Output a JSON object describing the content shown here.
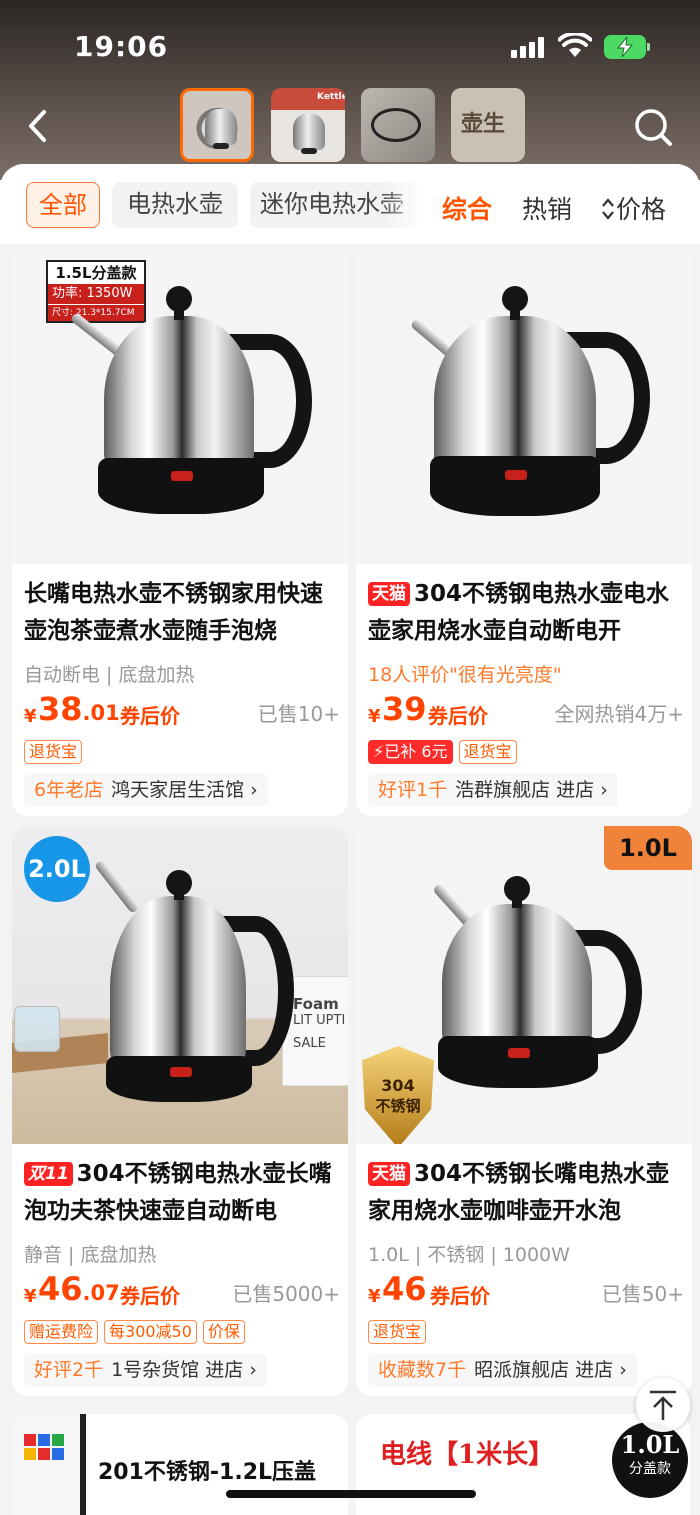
{
  "status_bar": {
    "time": "19:06"
  },
  "header": {
    "thumbnails": [
      {
        "name": "kettle-photo-1",
        "selected": true
      },
      {
        "name": "kettle-photo-2",
        "selected": false
      },
      {
        "name": "kettle-photo-3",
        "selected": false
      },
      {
        "name": "kettle-photo-4",
        "selected": false
      }
    ],
    "thumb2_brand": "Kettle",
    "thumb4_text": "壶生"
  },
  "filters": {
    "chips": [
      "全部",
      "电热水壶",
      "迷你电热水壶"
    ],
    "sorts": [
      "综合",
      "热销",
      "价格"
    ],
    "sort_icon": "updown-icon"
  },
  "products": [
    {
      "info_label": {
        "line1": "1.5L分盖款",
        "line2": "功率: 1350W",
        "line3": "尺寸: 21.3*15.7CM"
      },
      "badge_tag": "",
      "title": "长嘴电热水壶不锈钢家用快速壶泡茶壶煮水壶随手泡烧",
      "attrs": "自动断电 | 底盘加热",
      "price_int": "38",
      "price_dec": ".01",
      "price_note": "券后价",
      "sold": "已售10+",
      "badges": [
        "退货宝"
      ],
      "shop_prefix": "6年老店",
      "shop_name": "鸿天家居生活馆",
      "shop_link": "›"
    },
    {
      "badge_tag": "天猫",
      "title": "304不锈钢电热水壶电水壶家用烧水壶自动断电开",
      "attrs": "18人评价\"很有光亮度\"",
      "price_int": "39",
      "price_dec": "",
      "price_note": "券后价",
      "sold": "全网热销4万+",
      "badges": [
        "⚡已补 6元",
        "退货宝"
      ],
      "shop_prefix": "好评1千",
      "shop_name": "浩群旗舰店 进店",
      "shop_link": "›"
    },
    {
      "image_badge": "2.0L",
      "foam_text": "Foam",
      "foam_sub": "LIT UPTI",
      "foam_sale": "SALE",
      "badge_tag": "双11",
      "title": "304不锈钢电热水壶长嘴泡功夫茶快速壶自动断电",
      "attrs": "静音 | 底盘加热",
      "price_int": "46",
      "price_dec": ".07",
      "price_note": "券后价",
      "sold": "已售5000+",
      "badges": [
        "赠运费险",
        "每300减50",
        "价保"
      ],
      "shop_prefix": "好评2千",
      "shop_name": "1号杂货馆 进店",
      "shop_link": "›"
    },
    {
      "image_badge": "1.0L",
      "shield_line1": "304",
      "shield_line2": "不锈钢",
      "badge_tag": "天猫",
      "title": "304不锈钢长嘴电热水壶家用烧水壶咖啡壶开水泡",
      "attrs": "1.0L | 不锈钢 | 1000W",
      "price_int": "46",
      "price_dec": "",
      "price_note": "券后价",
      "sold": "已售50+",
      "badges": [
        "退货宝"
      ],
      "shop_prefix": "收藏数7千",
      "shop_name": "昭派旗舰店 进店",
      "shop_link": "›"
    }
  ],
  "peek": {
    "left_title": "201不锈钢-1.2L压盖",
    "right_title": "电线【1米长】",
    "split_badge_line1": "1.0L",
    "split_badge_line2": "分盖款"
  },
  "currency": "¥",
  "colors": {
    "accent": "#ff5500",
    "price": "#ff4400",
    "tmall": "#ff2222"
  }
}
